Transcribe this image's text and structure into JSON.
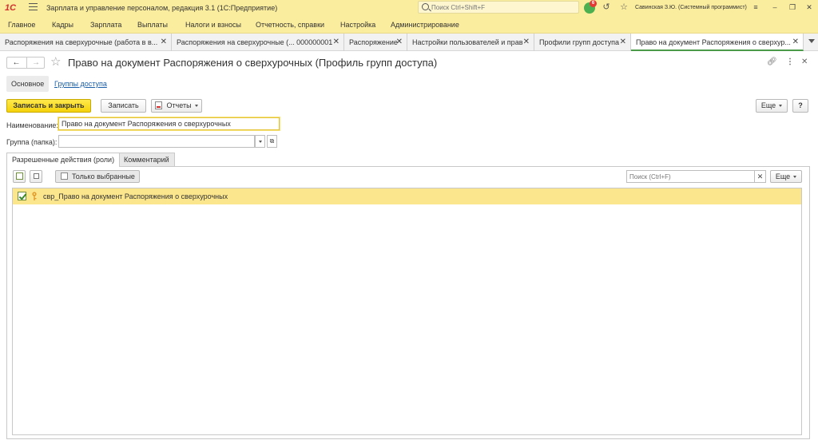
{
  "titlebar": {
    "logo": "1С",
    "app_title": "Зарплата и управление персоналом, редакция 3.1  (1С:Предприятие)",
    "search_placeholder": "Поиск Ctrl+Shift+F",
    "notification_count": "6",
    "user": "Савинская З.Ю. (Системный программист)"
  },
  "menu": {
    "items": [
      "Главное",
      "Кадры",
      "Зарплата",
      "Выплаты",
      "Налоги и взносы",
      "Отчетность, справки",
      "Настройка",
      "Администрирование"
    ]
  },
  "tabs": [
    {
      "label": "Распоряжения на сверхурочные (работа в в...",
      "active": false
    },
    {
      "label": "Распоряжения на сверхурочные (... 000000001",
      "active": false
    },
    {
      "label": "Распоряжение",
      "active": false
    },
    {
      "label": "Настройки пользователей и прав",
      "active": false
    },
    {
      "label": "Профили групп доступа",
      "active": false
    },
    {
      "label": "Право на документ Распоряжения о сверхур...",
      "active": true
    }
  ],
  "form": {
    "title": "Право на документ Распоряжения о сверхурочных (Профиль групп доступа)",
    "subnav_main": "Основное",
    "subnav_groups": "Группы доступа",
    "save_close": "Записать и закрыть",
    "save": "Записать",
    "reports": "Отчеты",
    "more": "Еще",
    "help": "?",
    "name_label": "Наименование:",
    "name_value": "Право на документ Распоряжения о сверхурочных",
    "group_label": "Группа (папка):",
    "group_value": ""
  },
  "inner_tabs": {
    "roles": "Разрешенные действия (роли)",
    "comment": "Комментарий"
  },
  "roles_panel": {
    "only_selected": "Только выбранные",
    "search_placeholder": "Поиск (Ctrl+F)",
    "more": "Еще",
    "rows": [
      {
        "checked": true,
        "label": "свр_Право на документ Распоряжения о сверхурочных"
      }
    ]
  }
}
